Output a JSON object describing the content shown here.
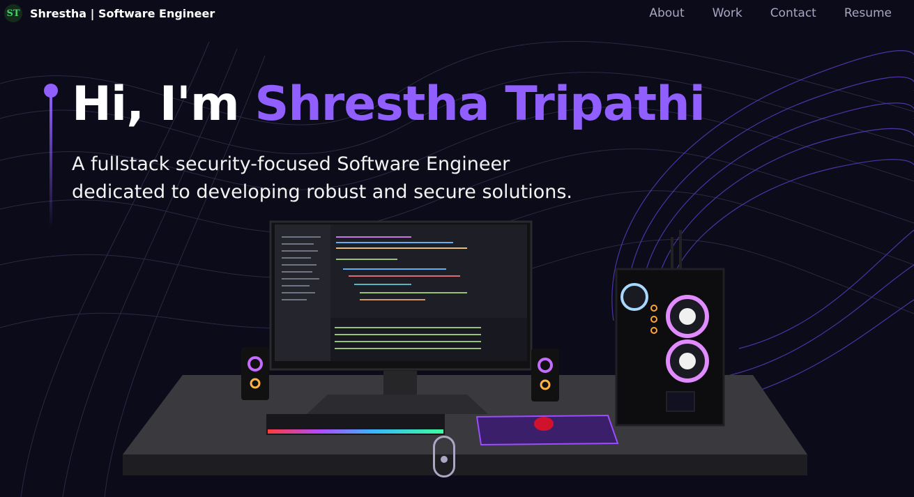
{
  "nav": {
    "logo_text": "ST",
    "brand": "Shrestha  | Software Engineer",
    "links": [
      "About",
      "Work",
      "Contact",
      "Resume"
    ]
  },
  "hero": {
    "greeting": "Hi, I'm ",
    "name": "Shrestha Tripathi",
    "subtitle_line1": "A fullstack security-focused Software Engineer",
    "subtitle_line2": "dedicated to developing robust and secure solutions."
  },
  "colors": {
    "background": "#0b0b1a",
    "accent": "#915eff",
    "nav_text": "#aaa6c3",
    "logo_green": "#3fd16a"
  },
  "icons": {
    "logo": "st-logo-icon",
    "scroll": "scroll-mouse-icon",
    "desk_scene": "computer-desk-3d-scene"
  }
}
